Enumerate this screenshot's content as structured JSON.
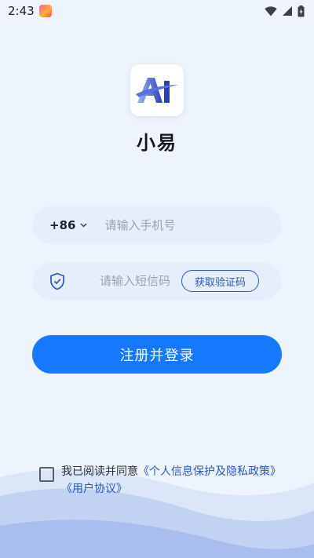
{
  "status_bar": {
    "time": "2:43",
    "icons": [
      "app-notification-icon",
      "wifi-icon",
      "signal-icon",
      "battery-charging-icon"
    ]
  },
  "app": {
    "logo_icon": "ai-logo-icon",
    "name": "小易"
  },
  "phone_field": {
    "country_code": "+86",
    "placeholder": "请输入手机号",
    "value": ""
  },
  "code_field": {
    "icon": "shield-check-icon",
    "placeholder": "请输入短信码",
    "value": "",
    "get_code_label": "获取验证码"
  },
  "register_button": {
    "label": "注册并登录"
  },
  "agreement": {
    "checked": false,
    "prefix": "我已阅读并同意",
    "privacy_policy": "《个人信息保护及隐私政策》",
    "user_agreement": "《用户协议》"
  },
  "colors": {
    "background": "#eef4fd",
    "primary": "#1677ff",
    "link": "#2856c6",
    "field_bg": "#e6eefb"
  }
}
